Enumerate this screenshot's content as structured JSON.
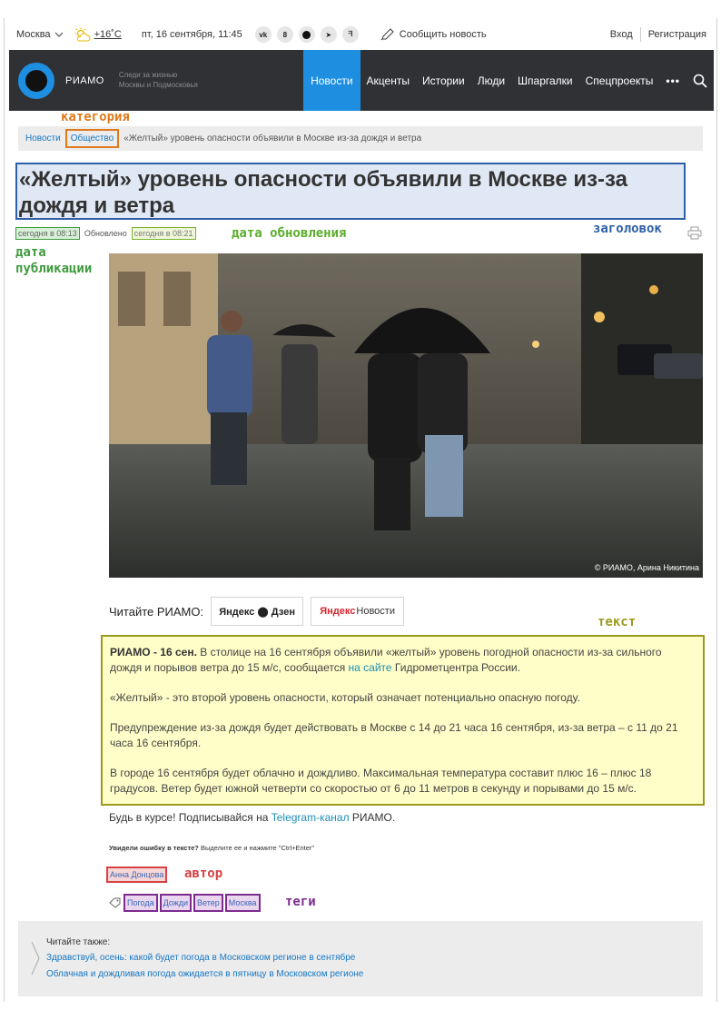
{
  "topbar": {
    "city": "Москва",
    "temp": "+16˚C",
    "datetime": "пт, 16 сентября, 11:45",
    "socials": [
      "вк",
      "ок",
      "дз",
      "тг",
      "rss"
    ],
    "report": "Сообщить новость",
    "login": "Вход",
    "register": "Регистрация"
  },
  "nav": {
    "logo": "РИАМО",
    "slogan_1": "Следи за жизнью",
    "slogan_2": "Москвы и Подмосковья",
    "items": [
      "Новости",
      "Акценты",
      "Истории",
      "Люди",
      "Шпаргалки",
      "Спецпроекты"
    ],
    "more": "•••"
  },
  "annotations": {
    "category": "категория",
    "headline": "заголовок",
    "updated": "дата обновления",
    "published_1": "дата",
    "published_2": "публикации",
    "text": "текст",
    "author": "автор",
    "tags": "теги"
  },
  "breadcrumbs": {
    "news": "Новости",
    "category": "Общество",
    "current": "«Желтый» уровень опасности объявили в Москве из-за дождя и ветра"
  },
  "article": {
    "title": "«Желтый» уровень опасности объявили в Москве из-за дождя и ветра",
    "published": "сегодня в 08:13",
    "updated_label": "Обновлено",
    "updated": "сегодня в 08:21",
    "photo_credit": "© РИАМО,  Арина Никитина",
    "read_label": "Читайте РИАМО:",
    "dzen": "Яндекс ⬤ Дзен",
    "ynews_1": "Яндекс",
    "ynews_2": "Новости",
    "lead": "РИАМО - 16 сен.",
    "p1_a": " В столице на 16 сентября объявили «желтый» уровень погодной опасности из-за сильного дождя и порывов ветра до 15 м/с, сообщается ",
    "p1_link": "на сайте",
    "p1_b": " Гидрометцентра России.",
    "p2": "«Желтый» - это второй уровень опасности, который означает потенциально опасную погоду.",
    "p3": "Предупреждение из-за дождя будет действовать в Москве с 14 до 21 часа 16 сентября, из-за ветра – с 11 до 21 часа 16 сентября.",
    "p4": "В городе 16 сентября будет облачно и дождливо. Максимальная температура составит плюс 16 – плюс 18 градусов. Ветер будет южной четверти со скоростью от 6 до 11 метров в секунду и порывами до 15 м/с.",
    "subscribe_a": "Будь в курсе! Подписывайся на ",
    "subscribe_link": "Telegram-канал",
    "subscribe_b": " РИАМО.",
    "typo_bold": "Увидели ошибку в тексте?",
    "typo_rest": " Выделите ее и нажмите \"Ctrl+Enter\"",
    "author": "Анна Донцова",
    "tags": [
      "Погода",
      "Дожди",
      "Ветер",
      "Москва"
    ]
  },
  "also": {
    "title": "Читайте также:",
    "link1": "Здравствуй, осень: какой будет погода в Московском регионе в сентябре",
    "link2": "Облачная и дождливая погода ожидается в пятницу в Московском регионе"
  },
  "colors": {
    "brand": "#1e8fe0",
    "nav_bg": "#2f3135",
    "category_box": "#e07a1a",
    "headline_box": "#2e60a8",
    "published_box": "#3e9a3e",
    "updated_label": "#5aae2a",
    "text_box": "#9a9a20",
    "author_box": "#d64242",
    "tags_box": "#7d2b8f"
  }
}
